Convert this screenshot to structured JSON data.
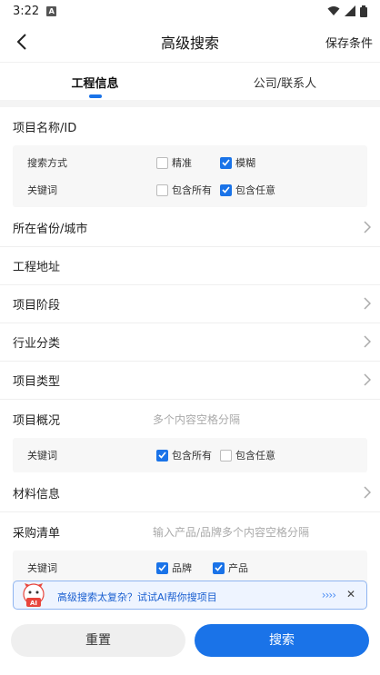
{
  "status_bar": {
    "time": "3:22"
  },
  "nav": {
    "title": "高级搜索",
    "save_label": "保存条件"
  },
  "tabs": [
    {
      "label": "工程信息"
    },
    {
      "label": "公司/联系人"
    }
  ],
  "project_name": {
    "label": "项目名称/ID",
    "search_mode_label": "搜索方式",
    "search_mode_options": [
      {
        "label": "精准",
        "checked": false
      },
      {
        "label": "模糊",
        "checked": true
      }
    ],
    "keyword_label": "关键词",
    "keyword_options": [
      {
        "label": "包含所有",
        "checked": false
      },
      {
        "label": "包含任意",
        "checked": true
      }
    ]
  },
  "rows": {
    "province_city": "所在省份/城市",
    "address": "工程地址",
    "stage": "项目阶段",
    "industry": "行业分类",
    "type": "项目类型"
  },
  "overview": {
    "label": "项目概况",
    "placeholder": "多个内容空格分隔",
    "keyword_label": "关键词",
    "keyword_options": [
      {
        "label": "包含所有",
        "checked": true
      },
      {
        "label": "包含任意",
        "checked": false
      }
    ]
  },
  "material": {
    "label": "材料信息"
  },
  "purchase": {
    "label": "采购清单",
    "placeholder": "输入产品/品牌多个内容空格分隔",
    "keyword_label": "关键词",
    "keyword_options": [
      {
        "label": "品牌",
        "checked": true
      },
      {
        "label": "产品",
        "checked": true
      }
    ]
  },
  "banner": {
    "text": "高级搜索太复杂？试试AI帮你搜项目",
    "mascot_text": "AI"
  },
  "footer": {
    "reset_label": "重置",
    "search_label": "搜索"
  },
  "colors": {
    "accent": "#1a73e8",
    "banner_bg": "#eef4ff"
  }
}
